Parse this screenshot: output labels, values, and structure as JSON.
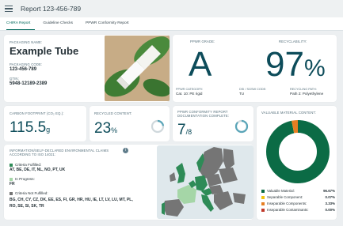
{
  "header": {
    "title": "Report 123-456-789"
  },
  "tabs": [
    {
      "label": "CHIRA Report",
      "active": true
    },
    {
      "label": "Guideline Checks",
      "active": false
    },
    {
      "label": "PPWR Conformity Report",
      "active": false
    }
  ],
  "packaging": {
    "name_label": "Packaging Name:",
    "name": "Example Tube",
    "code_label": "Packaging Code:",
    "code": "123-456-789",
    "gtin_label": "GTIN:",
    "gtin": "5948-12189-2389"
  },
  "ppwr": {
    "grade_label": "PPWR Grade:",
    "grade": "A",
    "recyclability_label": "Recyclability:",
    "recyclability_value": "97",
    "recyclability_unit": "%",
    "category_label": "PPWR Category:",
    "category": "Cat. 10: PE rigid",
    "sgsw_label": "DSI / SGSW Code:",
    "sgsw": "TU",
    "path_label": "Recycling Path:",
    "path": "Path 2: Polyethylene"
  },
  "metrics": {
    "carbon_label": "Carbon Footprint (CO₂ eq.):",
    "carbon_value": "115.5",
    "carbon_unit": "g",
    "recycled_label": "Recycled Content:",
    "recycled_value": "23",
    "recycled_unit": "%",
    "recycled_fraction": 0.23,
    "conformity_label": "PPWR Conformity Report Documentation Complete:",
    "conformity_value": "7",
    "conformity_total": "/8",
    "conformity_fraction": 0.875
  },
  "regions": {
    "title": "Information/Self-Declared Environmental Claims according to ISO 14021:",
    "fulfilled_label": "Criteria Fulfilled:",
    "fulfilled": "AT, BE, DE, IT, NL, NO, PT, UK",
    "progress_label": "In Progress:",
    "progress": "FR",
    "not_fulfilled_label": "Criteria Not Fulfilled:",
    "not_fulfilled_line1": "BG, CH, CY, CZ, DK, EE, ES, FI, GR, HR, HU, IE, LT, LV, LU, MT, PL,",
    "not_fulfilled_line2": "RO, SE, SI, SK, TR",
    "info_icon": "i"
  },
  "material": {
    "title": "Valuable Material Content:",
    "items": [
      {
        "label": "Valuable Material:",
        "value": "96.67%",
        "fraction": 0.9667,
        "color": "#0b6b45"
      },
      {
        "label": "Separable Component:",
        "value": "0.07%",
        "fraction": 0.0007,
        "color": "#f1c40f"
      },
      {
        "label": "Inseparable Components:",
        "value": "3.33%",
        "fraction": 0.0333,
        "color": "#e67e22"
      },
      {
        "label": "Inseparable Contaminants:",
        "value": "0.00%",
        "fraction": 0.0,
        "color": "#c0392b"
      }
    ]
  },
  "colors": {
    "accent": "#00695c",
    "fulfilled": "#2e8b57",
    "progress": "#a5d6a7",
    "not_fulfilled": "#757575"
  }
}
